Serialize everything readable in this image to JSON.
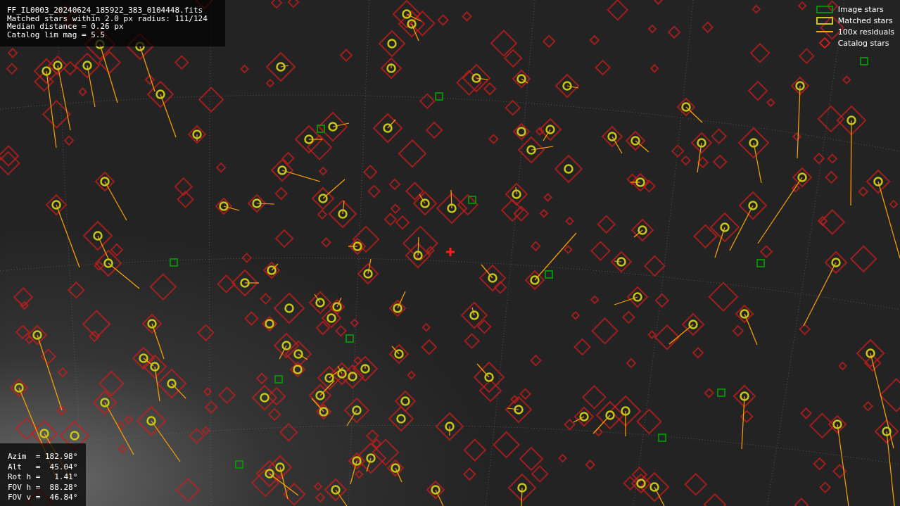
{
  "info_panel": {
    "lines": [
      "FF_IL0003_20240624_185922_383_0104448.fits",
      "Matched stars within 2.0 px radius: 111/124",
      "Median distance = 0.26 px",
      "Catalog lim mag = 5.5"
    ]
  },
  "legend": [
    {
      "kind": "box",
      "label": "Image stars",
      "color": "#0a8a0a"
    },
    {
      "kind": "box",
      "label": "Matched stars",
      "color": "#c8c814"
    },
    {
      "kind": "line",
      "label": "100x residuals",
      "color": "#ffa500"
    },
    {
      "kind": "diamond",
      "label": "Catalog stars",
      "color": "#c81e1e"
    }
  ],
  "pointing_panel": {
    "lines": [
      "Azim  = 182.98°",
      "Alt   =  45.04°",
      "Rot h =   1.41°",
      "FOV h =  88.28°",
      "FOV v =  46.84°"
    ]
  }
}
